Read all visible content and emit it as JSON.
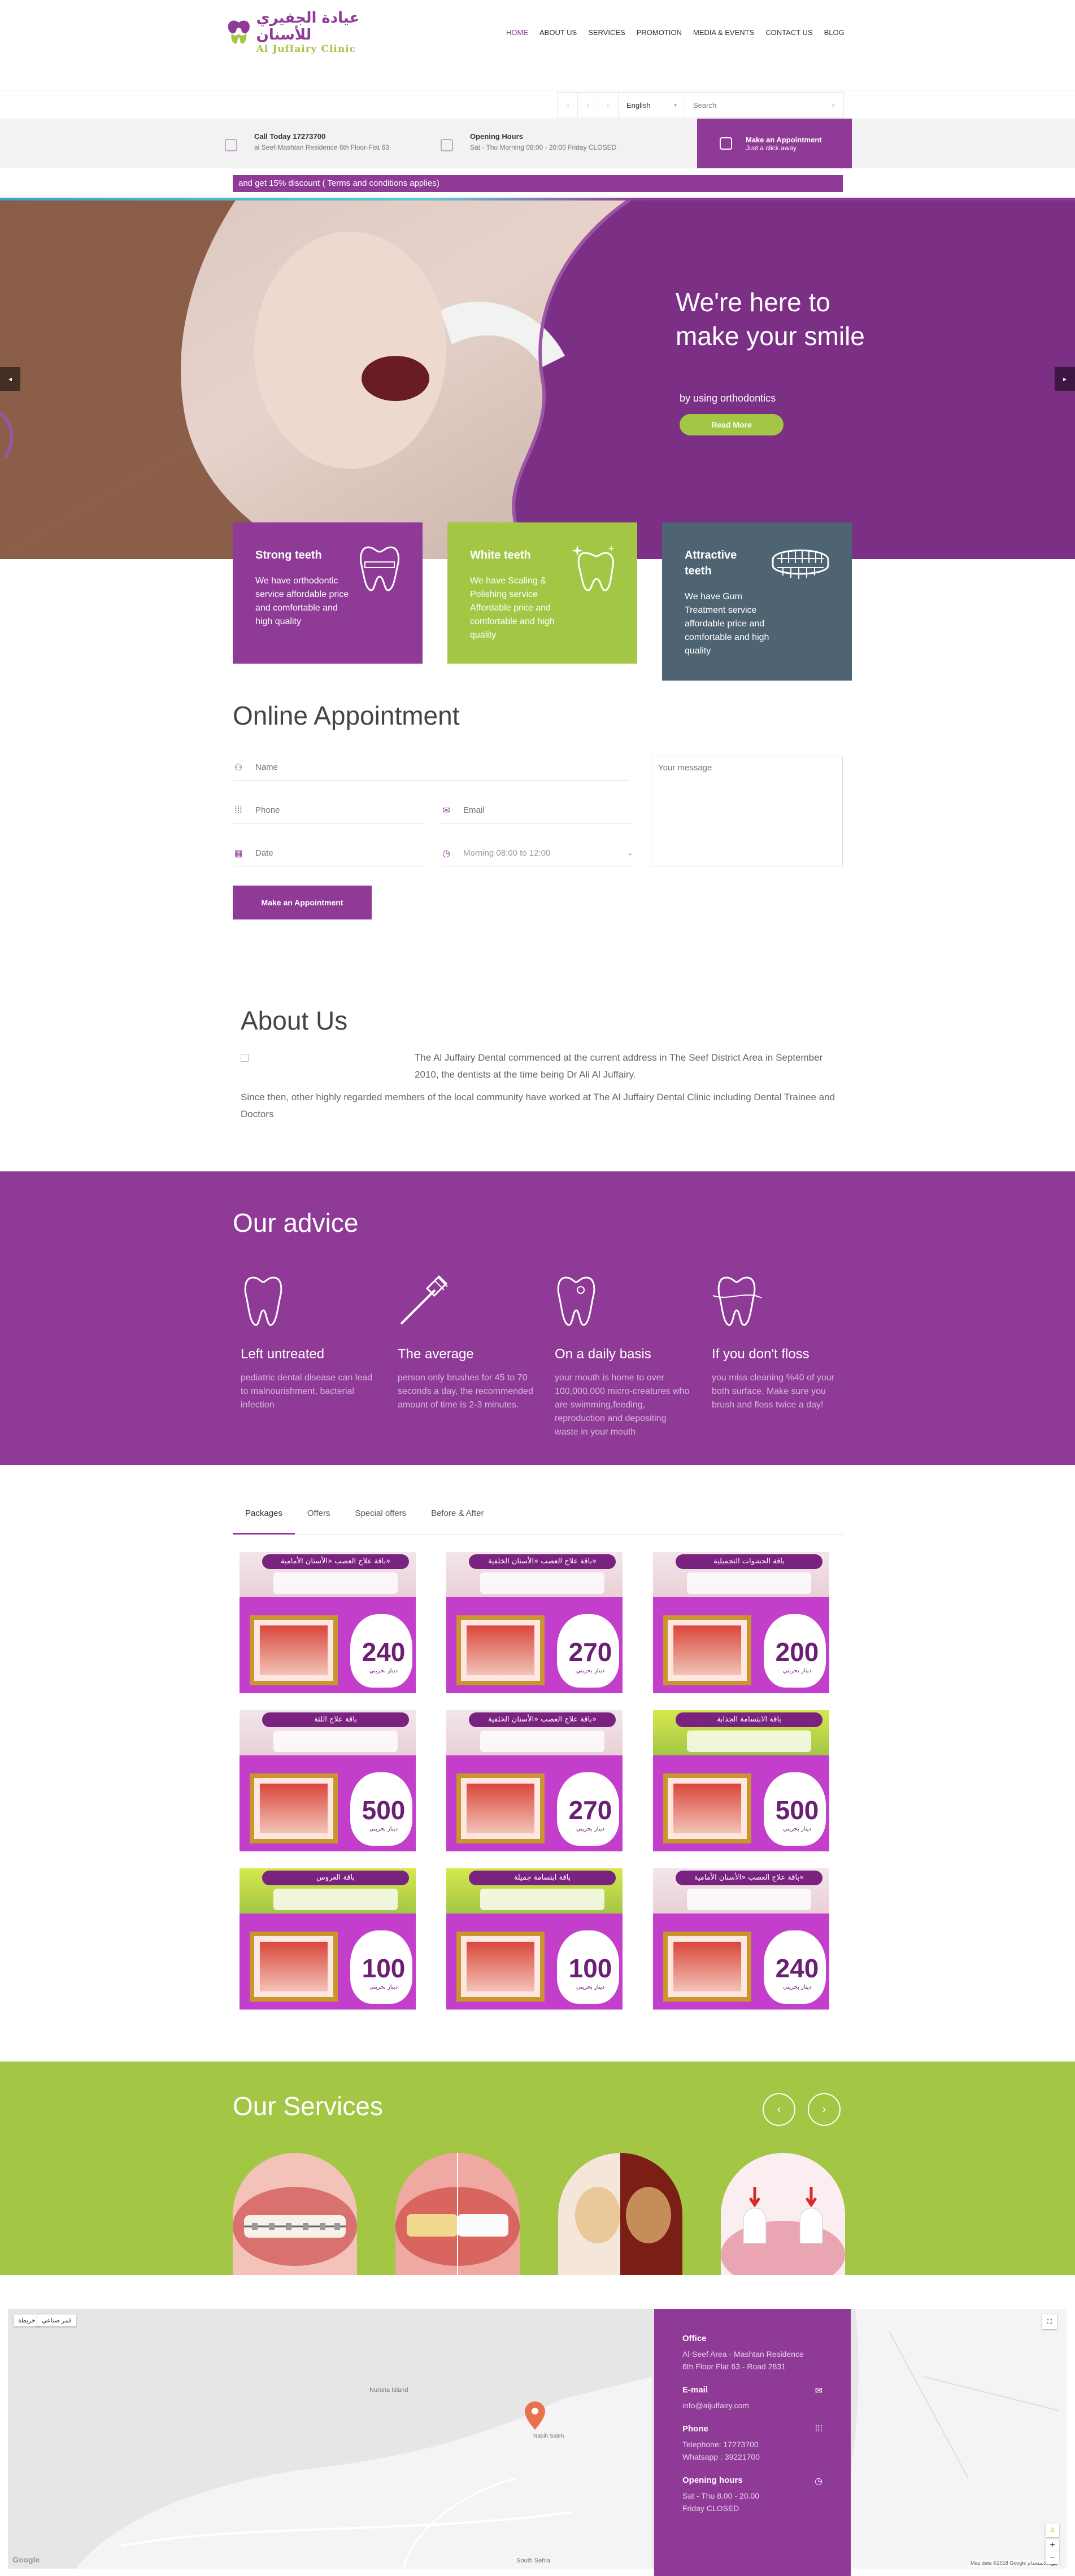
{
  "header": {
    "logo_ar": "عيادة الجفيري للأسنان",
    "logo_en": "Al Juffairy Clinic",
    "nav": [
      "HOME",
      "ABOUT US",
      "SERVICES",
      "PROMOTION",
      "MEDIA & EVENTS",
      "CONTACT US",
      "BLOG"
    ],
    "language": "English",
    "search_placeholder": "Search"
  },
  "info": {
    "call_title": "Call Today 17273700",
    "call_sub": "al Seef-Mashtan Residence 6th Floor-Flat 63",
    "hours_title": "Opening Hours",
    "hours_sub": "Sat - Thu Morning 08:00 - 20:00 Friday CLOSED",
    "appt_title": "Make an Appointment",
    "appt_sub": "Just a click away"
  },
  "promo": "and get 15% discount ( Terms and conditions applies)",
  "hero": {
    "title": "We're here to make your smile",
    "subtitle": "by using orthodontics",
    "button": "Read More"
  },
  "features": [
    {
      "title": "Strong teeth",
      "text": "We have orthodontic service affordable price and comfortable and high quality",
      "color": "#8e3a96"
    },
    {
      "title": "White teeth",
      "text": "We have Scaling & Polishing service Affordable price and comfortable and high quality",
      "color": "#a3c745"
    },
    {
      "title": "Attractive teeth",
      "text": "We have Gum Treatment service affordable price and comfortable and high quality",
      "color": "#4f6472"
    }
  ],
  "appointment": {
    "title": "Online Appointment",
    "name": "Name",
    "phone": "Phone",
    "email": "Email",
    "date": "Date",
    "time": "Morning 08:00 to 12:00",
    "message": "Your message",
    "submit": "Make an Appointment"
  },
  "about": {
    "title": "About Us",
    "p1": "The Al Juffairy Dental commenced at the current address in The Seef District Area in September 2010, the dentists at the time being Dr Ali Al Juffairy.",
    "p2": "Since then, other highly regarded members of the local community have worked at The Al Juffairy Dental Clinic including Dental Trainee and Doctors"
  },
  "advice": {
    "title": "Our advice",
    "items": [
      {
        "title": "Left untreated",
        "text": "pediatric dental disease can lead to malnourishment, bacterial infection"
      },
      {
        "title": "The average",
        "text": "person only brushes for 45 to 70 seconds a day, the recommended amount of time is 2-3 minutes."
      },
      {
        "title": "On a daily basis",
        "text": "your mouth is home to over 100,000,000 micro-creatures who are swimming,feeding, reproduction and depositing waste in your mouth"
      },
      {
        "title": "If you don't floss",
        "text": "you miss cleaning %40 of your both surface. Make sure you brush and floss twice a day!"
      }
    ]
  },
  "tabs": [
    "Packages",
    "Offers",
    "Special offers",
    "Before & After"
  ],
  "packages": [
    {
      "title": "باقة علاج العصب «الأسنان الأمامية»",
      "price": "240",
      "style": ""
    },
    {
      "title": "باقة علاج العصب «الأسنان الخلفية»",
      "price": "270",
      "style": ""
    },
    {
      "title": "باقة الحشوات التجميلية",
      "price": "200",
      "style": ""
    },
    {
      "title": "باقة علاج اللثة",
      "price": "500",
      "style": ""
    },
    {
      "title": "باقة علاج العصب «الأسنان الخلفية»",
      "price": "270",
      "style": ""
    },
    {
      "title": "باقة الابتسامة الجذابة",
      "price": "500",
      "style": "green"
    },
    {
      "title": "باقة العروس",
      "price": "100",
      "style": "green"
    },
    {
      "title": "باقة ابتسامة جميلة",
      "price": "100",
      "style": "green"
    },
    {
      "title": "باقة علاج العصب «الأسنان الأمامية»",
      "price": "240",
      "style": ""
    }
  ],
  "package_currency": "دينار بحريني",
  "services": {
    "title": "Our Services"
  },
  "contact": {
    "office_title": "Office",
    "office_1": "Al-Seef Area - Mashtan Residence",
    "office_2": "6th Floor Flat 63 - Road 2831",
    "email_title": "E-mail",
    "email": "info@aljuffairy.com",
    "phone_title": "Phone",
    "tel": "Telephone: 17273700",
    "whatsapp": "Whatsapp : 39221700",
    "hours_title": "Opening hours",
    "hours_1": "Sat - Thu 8.00 - 20.00",
    "hours_2": "Friday CLOSED"
  },
  "map": {
    "btn_map": "خريطة",
    "btn_sat": "قمر صناعي",
    "label_nabih": "Nabih Saleh",
    "label_sitra": "South Sehla",
    "label_nurana": "Nurana Island",
    "label_google": "Google",
    "footer": "Map data ©2018 Google  بنود الاستخدام"
  },
  "colors": {
    "purple": "#8e3a96",
    "green": "#a3c745",
    "slate": "#4f6472"
  }
}
